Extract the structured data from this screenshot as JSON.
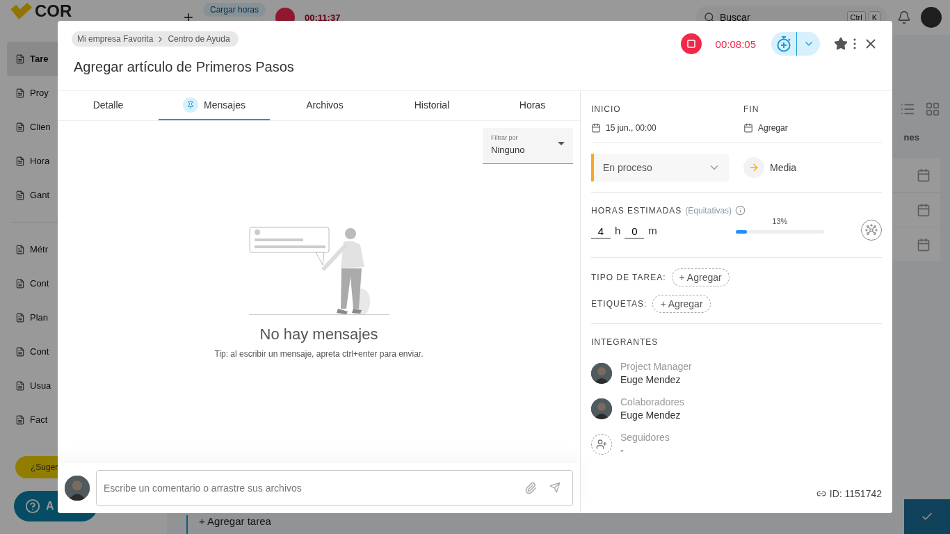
{
  "background": {
    "logo": "COR",
    "add_button": "+",
    "load_hours": "Cargar horas",
    "timer": "00:11:37",
    "search": {
      "placeholder": "Buscar"
    },
    "shortcut": [
      "Ctrl",
      "K"
    ],
    "sidebar_groups": [
      [
        {
          "label": "Tare",
          "selected": true
        },
        {
          "label": "Proy",
          "selected": false
        },
        {
          "label": "Clien",
          "selected": false
        },
        {
          "label": "Hora",
          "selected": false
        },
        {
          "label": "Gant",
          "selected": false
        }
      ],
      [
        {
          "label": "Métr",
          "selected": false
        },
        {
          "label": "Cont",
          "selected": false
        },
        {
          "label": "Plan",
          "selected": false
        },
        {
          "label": "Cont",
          "selected": false
        },
        {
          "label": "Usua",
          "selected": false
        },
        {
          "label": "Fact",
          "selected": false
        }
      ]
    ],
    "suggest": "¿Suger",
    "help": "A",
    "column_heading": "nes",
    "add_task": "+ Agregar tarea"
  },
  "modal": {
    "breadcrumb": [
      "Mi empresa Favorita",
      "Centro de Ayuda"
    ],
    "title": "Agregar artículo de Primeros Pasos",
    "timer": {
      "running": true,
      "time": "00:08:05"
    },
    "tabs": [
      {
        "label": "Detalle",
        "selected": false
      },
      {
        "label": "Mensajes",
        "selected": true
      },
      {
        "label": "Archivos",
        "selected": false
      },
      {
        "label": "Historial",
        "selected": false
      },
      {
        "label": "Horas",
        "selected": false
      }
    ],
    "filter": {
      "label": "Filtrar por",
      "value": "Ninguno"
    },
    "empty": {
      "title": "No hay mensajes",
      "tip": "Tip: al escribir un mensaje, apreta ctrl+enter para enviar."
    },
    "comment": {
      "placeholder": "Escribe un comentario o arrastre sus archivos"
    },
    "start": {
      "label": "INICIO",
      "value": "15 jun., 00:00"
    },
    "end": {
      "label": "FIN",
      "value": "Agregar"
    },
    "status": {
      "value": "En proceso"
    },
    "priority": {
      "value": "Media"
    },
    "hours": {
      "label": "HORAS ESTIMADAS",
      "note": "(Equitativas)",
      "hours": "4",
      "hours_unit": "h",
      "minutes": "0",
      "minutes_unit": "m",
      "progress": {
        "reading": "13%",
        "level": 0.13
      }
    },
    "task_type": {
      "label": "TIPO DE TAREA:",
      "action": "+ Agregar"
    },
    "tags": {
      "label": "ETIQUETAS:",
      "action": "+ Agregar"
    },
    "members": {
      "heading": "INTEGRANTES",
      "groups": [
        {
          "kind": "person",
          "role": "Project Manager",
          "name": "Euge Mendez"
        },
        {
          "kind": "person",
          "role": "Colaboradores",
          "name": "Euge Mendez"
        },
        {
          "kind": "add",
          "role": "Seguidores",
          "name": "-"
        }
      ]
    },
    "id": "ID: 1151742"
  }
}
